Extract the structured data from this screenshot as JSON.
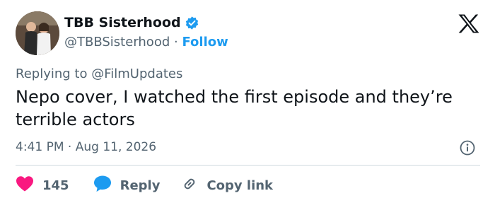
{
  "user": {
    "display_name": "TBB Sisterhood",
    "handle": "@TBBSisterhood",
    "separator": "·",
    "follow_label": "Follow"
  },
  "tweet": {
    "replying_prefix": "Replying to",
    "replying_mention": "@FilmUpdates",
    "text": "Nepo cover, I watched the first episode and they’re terrible actors",
    "time": "4:41 PM",
    "date_separator": "·",
    "date": "Aug 11, 2026"
  },
  "actions": {
    "like_count": "145",
    "reply_label": "Reply",
    "copy_label": "Copy link"
  },
  "colors": {
    "accent": "#1d9bf0",
    "like": "#f91880",
    "muted": "#536471",
    "text": "#0f1419"
  },
  "icons": [
    "verified-badge-icon",
    "x-logo-icon",
    "info-icon",
    "heart-icon",
    "reply-bubble-icon",
    "link-icon"
  ]
}
